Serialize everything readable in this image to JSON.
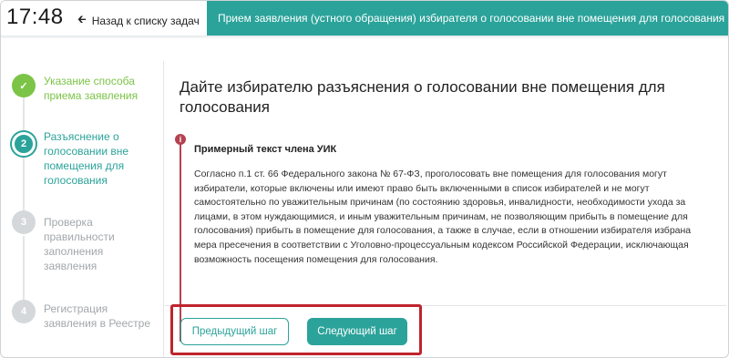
{
  "header": {
    "time": "17:48",
    "back_label": "Назад к списку задач",
    "title": "Прием заявления (устного обращения) избирателя о голосовании вне помещения для голосования",
    "accent_color": "#2ba39a"
  },
  "sidebar": {
    "steps": [
      {
        "number": "✓",
        "label": "Указание способа приема заявления",
        "state": "done"
      },
      {
        "number": "2",
        "label": "Разъяснение о голосовании вне помещения для голосования",
        "state": "active"
      },
      {
        "number": "3",
        "label": "Проверка правильности заполнения заявления",
        "state": "pending"
      },
      {
        "number": "4",
        "label": "Регистрация заявления в Реестре",
        "state": "pending"
      }
    ]
  },
  "main": {
    "title": "Дайте избирателю разъяснения о голосовании вне помещения для голосования",
    "note": {
      "icon": "i",
      "heading": "Примерный текст члена УИК",
      "text": "Согласно п.1 ст. 66 Федерального закона № 67-ФЗ, проголосовать вне помещения для голосования могут избиратели, которые включены или имеют право быть включенными в список избирателей и не могут самостоятельно по уважительным причинам (по состоянию здоровья, инвалидности, необходимости ухода за лицами, в этом нуждающимися, и иным уважительным причинам, не позволяющим прибыть в помещение для голосования) прибыть в помещение для голосования, а также в случае, если в отношении избирателя избрана мера пресечения в соответствии с Уголовно-процессуальным кодексом Российской Федерации, исключающая возможность посещения помещения для голосования."
    },
    "buttons": {
      "prev_label": "Предыдущий шаг",
      "next_label": "Следующий шаг"
    }
  }
}
